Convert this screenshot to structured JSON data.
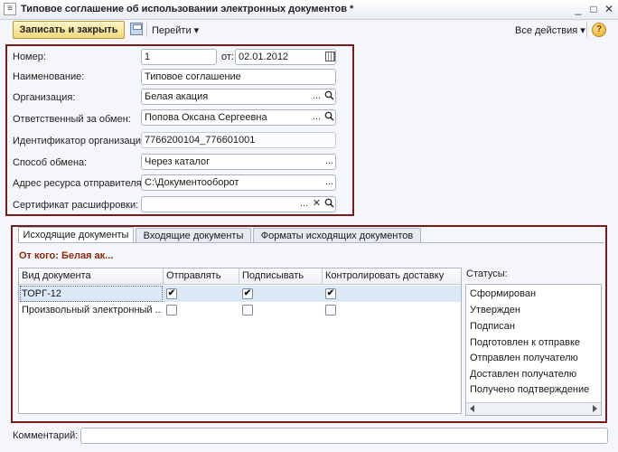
{
  "window": {
    "title": "Типовое соглашение об использовании электронных документов *",
    "min": "_",
    "max": "□",
    "close": "✕"
  },
  "toolbar": {
    "save_close": "Записать и закрыть",
    "goto": "Перейти ▾",
    "all_actions": "Все действия ▾",
    "help": "?"
  },
  "form": {
    "number_label": "Номер:",
    "number_value": "1",
    "date_label": "от:",
    "date_value": "02.01.2012",
    "name_label": "Наименование:",
    "name_value": "Типовое соглашение",
    "org_label": "Организация:",
    "org_value": "Белая акация",
    "resp_label": "Ответственный за обмен:",
    "resp_value": "Попова Оксана Сергеевна",
    "orgid_label": "Идентификатор организации:",
    "orgid_value": "7766200104_776601001",
    "method_label": "Способ обмена:",
    "method_value": "Через каталог",
    "addr_label": "Адрес ресурса отправителя:",
    "addr_value": "C:\\Документооборот",
    "cert_label": "Сертификат расшифровки:",
    "cert_value": ""
  },
  "icons": {
    "ellipsis": "...",
    "search": "🔍",
    "clear": "✕"
  },
  "tabs": [
    {
      "label": "Исходящие документы"
    },
    {
      "label": "Входящие документы"
    },
    {
      "label": "Форматы исходящих документов"
    }
  ],
  "from_label": "От кого: Белая ак...",
  "table": {
    "headers": [
      "Вид документа",
      "Отправлять",
      "Подписывать",
      "Контролировать доставку"
    ],
    "rows": [
      {
        "doc": "ТОРГ-12",
        "send": true,
        "sign": true,
        "control": true
      },
      {
        "doc": "Произвольный электронный ...",
        "send": false,
        "sign": false,
        "control": false
      }
    ]
  },
  "statuses": {
    "label": "Статусы:",
    "items": [
      "Сформирован",
      "Утвержден",
      "Подписан",
      "Подготовлен к отправке",
      "Отправлен получателю",
      "Доставлен получателю",
      "Получено подтверждение"
    ]
  },
  "comment": {
    "label": "Комментарий:",
    "value": ""
  },
  "colors": {
    "accent_border": "#7b1a1a",
    "save_button": "#f2d77a",
    "selected_row": "#dde8f7"
  }
}
